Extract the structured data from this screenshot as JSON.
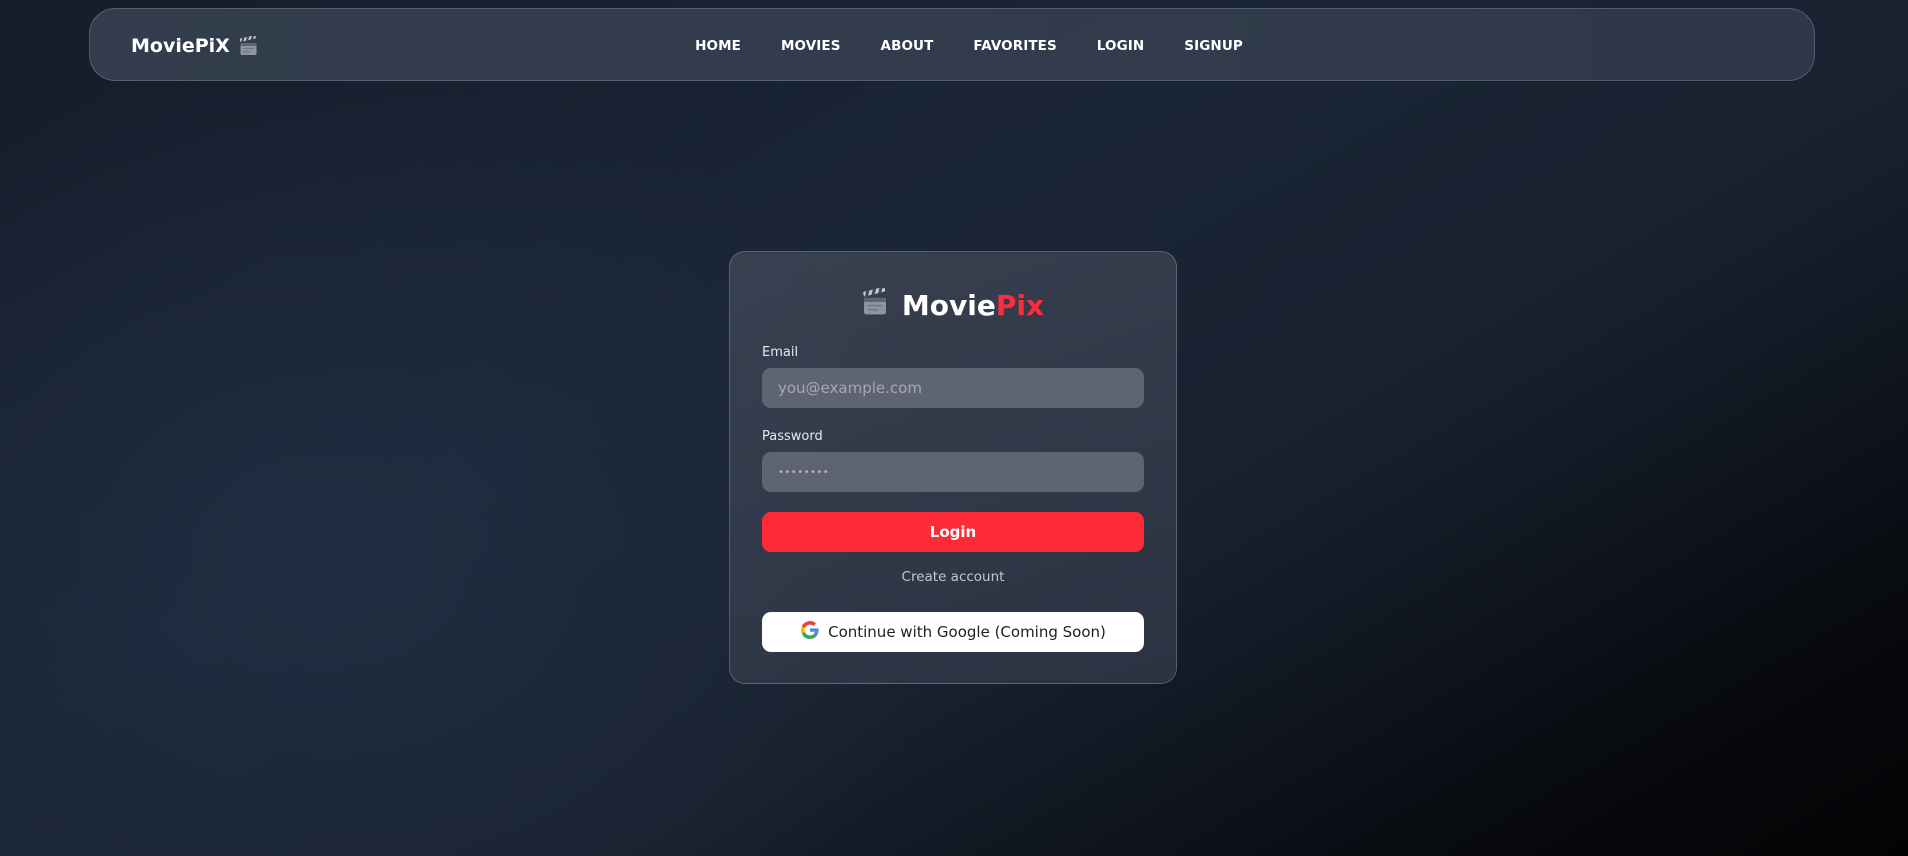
{
  "nav": {
    "brand": "MoviePiX",
    "brand_icon": "clapperboard-icon",
    "links": [
      "HOME",
      "MOVIES",
      "ABOUT",
      "FAVORITES",
      "LOGIN",
      "SIGNUP"
    ]
  },
  "login_card": {
    "title_part1": "Movie",
    "title_part2": "Pix",
    "title_icon": "clapperboard-icon",
    "email_label": "Email",
    "email_placeholder": "you@example.com",
    "password_label": "Password",
    "password_placeholder": "••••••••",
    "login_button": "Login",
    "create_account": "Create account",
    "google_button": "Continue with Google (Coming Soon)",
    "google_icon": "google-icon"
  },
  "colors": {
    "accent_red": "#ff2a37",
    "title_red": "#ff2d3b",
    "input_bg": "#5e6470",
    "card_bg": "#3a4252"
  }
}
